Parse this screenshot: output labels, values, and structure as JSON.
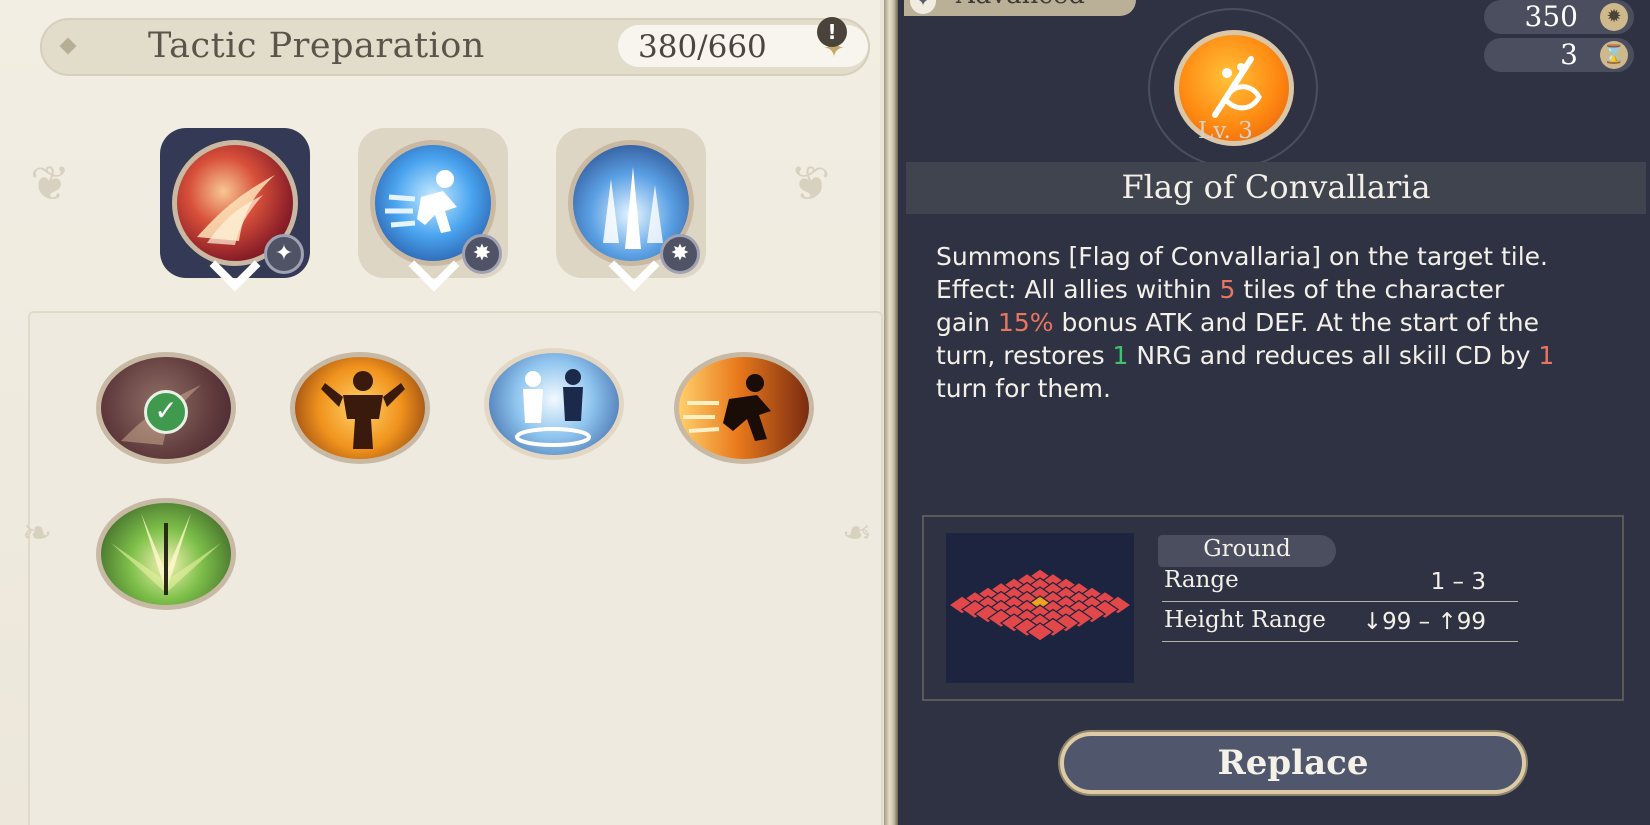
{
  "header": {
    "title": "Tactic Preparation",
    "points": "380/660"
  },
  "detail": {
    "tier": "Advanced",
    "cost": "350",
    "cooldown": "3",
    "level": "Lv. 3",
    "name": "Flag of Convallaria",
    "desc": {
      "p1": "Summons [Flag of Convallaria] on the target tile. Effect: All allies within ",
      "n1": "5",
      "p2": " tiles of the character gain ",
      "n2": "15%",
      "p3": " bonus ATK and DEF. At the start of the turn, restores ",
      "n3": "1",
      "p4": " NRG and reduces all skill CD by ",
      "n4": "1",
      "p5": " turn for them."
    },
    "targeting": "Ground",
    "range_label": "Range",
    "range_value": "1 – 3",
    "height_label": "Height Range",
    "height_value": "↓99 – ↑99"
  },
  "replace_label": "Replace",
  "icons": {
    "points": "star-icon",
    "alert": "exclamation-icon",
    "cost": "sun-icon",
    "cooldown": "hourglass-icon",
    "skill_badge": "sparkle-icon",
    "selected": "check-icon"
  },
  "colors": {
    "highlight_red": "#e9765f",
    "highlight_green": "#3fc46d",
    "panel_dark": "#2f3242",
    "panel_light": "#efeadf"
  }
}
